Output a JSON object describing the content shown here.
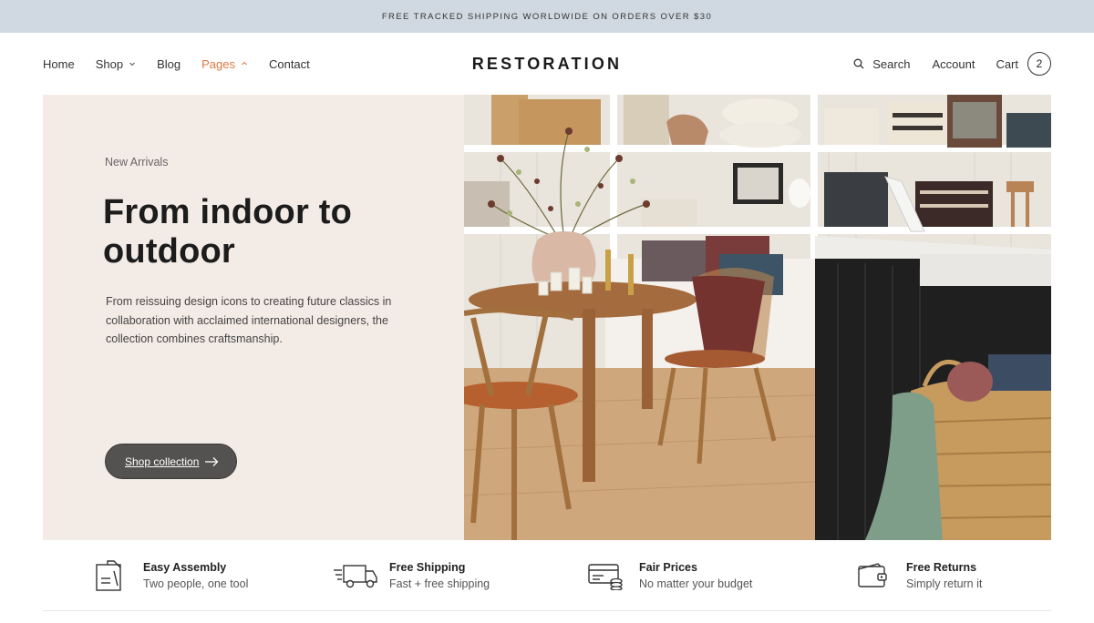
{
  "announcement": "FREE TRACKED SHIPPING WORLDWIDE ON ORDERS OVER $30",
  "nav": {
    "home": "Home",
    "shop": "Shop",
    "blog": "Blog",
    "pages": "Pages",
    "contact": "Contact"
  },
  "logo": "RESTORATION",
  "nav_right": {
    "search": "Search",
    "account": "Account",
    "cart": "Cart",
    "cart_count": "2"
  },
  "hero": {
    "eyebrow": "New Arrivals",
    "title": "From indoor to outdoor",
    "text": "From reissuing design icons to creating future classics in collaboration with acclaimed international designers, the collection combines craftsmanship.",
    "cta": "Shop collection"
  },
  "features": [
    {
      "title": "Easy Assembly",
      "subtitle": "Two people, one tool",
      "icon": "assembly-icon"
    },
    {
      "title": "Free Shipping",
      "subtitle": "Fast + free shipping",
      "icon": "truck-icon"
    },
    {
      "title": "Fair Prices",
      "subtitle": "No matter your budget",
      "icon": "price-icon"
    },
    {
      "title": "Free Returns",
      "subtitle": "Simply return it",
      "icon": "wallet-icon"
    }
  ],
  "colors": {
    "announcement_bg": "#d0d9e2",
    "hero_bg": "#f3ebe6",
    "accent": "#e07840",
    "button_bg": "#545250"
  }
}
